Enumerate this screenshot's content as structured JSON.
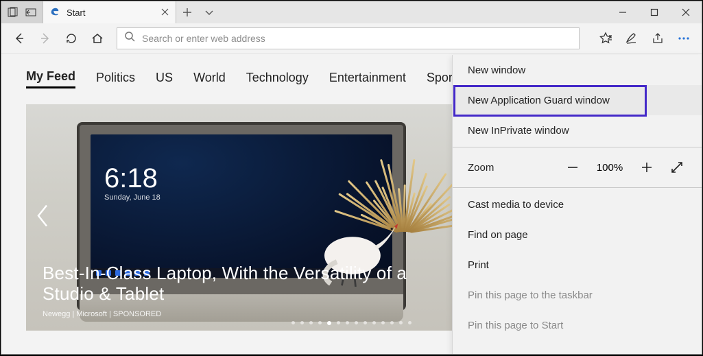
{
  "tab": {
    "title": "Start"
  },
  "addressbar": {
    "placeholder": "Search or enter web address",
    "value": ""
  },
  "nav_items": [
    {
      "label": "My Feed",
      "active": true
    },
    {
      "label": "Politics",
      "active": false
    },
    {
      "label": "US",
      "active": false
    },
    {
      "label": "World",
      "active": false
    },
    {
      "label": "Technology",
      "active": false
    },
    {
      "label": "Entertainment",
      "active": false
    },
    {
      "label": "Sports",
      "active": false
    }
  ],
  "hero": {
    "headline": "Best-In-Class Laptop, With the Versatility of a Studio & Tablet",
    "byline": "Newegg | Microsoft | SPONSORED",
    "lockscreen_time": "6:18",
    "lockscreen_date": "Sunday, June 18",
    "dot_count": 14,
    "dot_active_index": 4
  },
  "menu": {
    "new_window": "New window",
    "new_app_guard": "New Application Guard window",
    "new_inprivate": "New InPrivate window",
    "zoom_label": "Zoom",
    "zoom_value": "100%",
    "cast": "Cast media to device",
    "find": "Find on page",
    "print": "Print",
    "pin_taskbar": "Pin this page to the taskbar",
    "pin_start": "Pin this page to Start"
  },
  "icons": {
    "tabs_aside": "tabs-aside-icon",
    "show_tabs": "show-all-tabs-icon",
    "edge": "edge-icon",
    "close": "close-icon",
    "newtab": "new-tab-icon",
    "caret": "tab-preview-icon",
    "min": "minimize-icon",
    "max": "maximize-icon",
    "winclose": "window-close-icon",
    "back": "back-icon",
    "forward": "forward-icon",
    "refresh": "refresh-icon",
    "home": "home-icon",
    "search": "search-icon",
    "fav": "favorites-icon",
    "ink": "ink-icon",
    "share": "share-icon",
    "more": "more-icon",
    "minus": "zoom-out-icon",
    "plus": "zoom-in-icon",
    "full": "fullscreen-icon",
    "chev_l": "chevron-left-icon",
    "chev_r": "chevron-right-icon"
  }
}
